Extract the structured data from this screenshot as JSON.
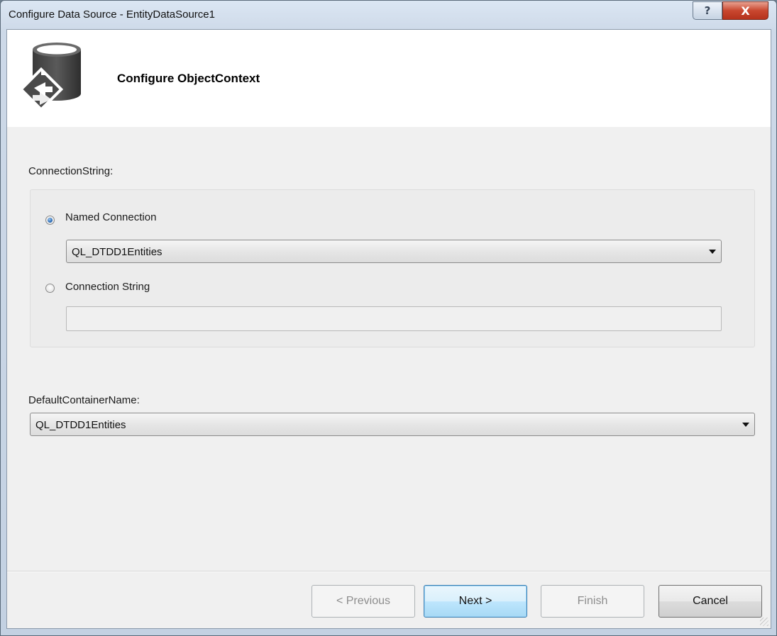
{
  "window": {
    "title": "Configure Data Source - EntityDataSource1",
    "help_glyph": "?",
    "close_glyph": "X"
  },
  "header": {
    "title": "Configure ObjectContext",
    "icon": "database-entity-icon"
  },
  "connection_string": {
    "label": "ConnectionString:",
    "named_connection": {
      "label": "Named Connection",
      "selected": true,
      "value": "QL_DTDD1Entities"
    },
    "connection_string_option": {
      "label": "Connection String",
      "selected": false,
      "value": ""
    }
  },
  "default_container": {
    "label": "DefaultContainerName:",
    "value": "QL_DTDD1Entities"
  },
  "buttons": {
    "previous": "< Previous",
    "next": "Next >",
    "finish": "Finish",
    "cancel": "Cancel"
  },
  "colors": {
    "close_button": "#c9472f",
    "default_button_border": "#3c7fb1",
    "radio_selected": "#2c6cb5"
  }
}
